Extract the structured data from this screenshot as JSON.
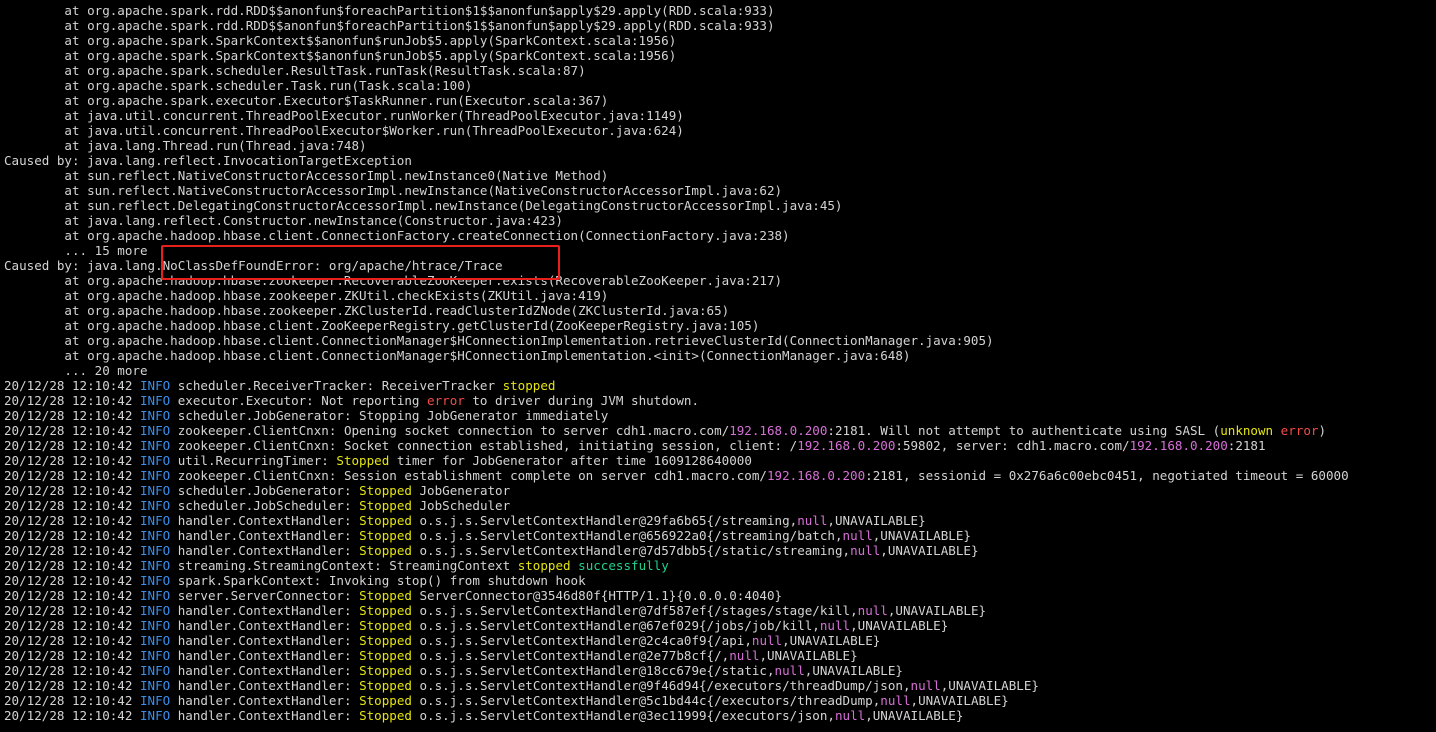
{
  "terminal": {
    "colors": {
      "background": "#000000",
      "text": "#d4d4d4",
      "info": "#3b8eea",
      "stopped": "#e5e510",
      "error": "#f14c4c",
      "ip": "#d670d6",
      "success": "#23d18b",
      "highlight_box": "#e8201c"
    },
    "lines": [
      [
        {
          "t": "        at org.apache.spark.rdd.RDD$$anonfun$foreachPartition$1$$anonfun$apply$29.apply(RDD.scala:933)",
          "c": "plain"
        }
      ],
      [
        {
          "t": "        at org.apache.spark.rdd.RDD$$anonfun$foreachPartition$1$$anonfun$apply$29.apply(RDD.scala:933)",
          "c": "plain"
        }
      ],
      [
        {
          "t": "        at org.apache.spark.SparkContext$$anonfun$runJob$5.apply(SparkContext.scala:1956)",
          "c": "plain"
        }
      ],
      [
        {
          "t": "        at org.apache.spark.SparkContext$$anonfun$runJob$5.apply(SparkContext.scala:1956)",
          "c": "plain"
        }
      ],
      [
        {
          "t": "        at org.apache.spark.scheduler.ResultTask.runTask(ResultTask.scala:87)",
          "c": "plain"
        }
      ],
      [
        {
          "t": "        at org.apache.spark.scheduler.Task.run(Task.scala:100)",
          "c": "plain"
        }
      ],
      [
        {
          "t": "        at org.apache.spark.executor.Executor$TaskRunner.run(Executor.scala:367)",
          "c": "plain"
        }
      ],
      [
        {
          "t": "        at java.util.concurrent.ThreadPoolExecutor.runWorker(ThreadPoolExecutor.java:1149)",
          "c": "plain"
        }
      ],
      [
        {
          "t": "        at java.util.concurrent.ThreadPoolExecutor$Worker.run(ThreadPoolExecutor.java:624)",
          "c": "plain"
        }
      ],
      [
        {
          "t": "        at java.lang.Thread.run(Thread.java:748)",
          "c": "plain"
        }
      ],
      [
        {
          "t": "Caused by: java.lang.reflect.InvocationTargetException",
          "c": "plain"
        }
      ],
      [
        {
          "t": "        at sun.reflect.NativeConstructorAccessorImpl.newInstance0(Native Method)",
          "c": "plain"
        }
      ],
      [
        {
          "t": "        at sun.reflect.NativeConstructorAccessorImpl.newInstance(NativeConstructorAccessorImpl.java:62)",
          "c": "plain"
        }
      ],
      [
        {
          "t": "        at sun.reflect.DelegatingConstructorAccessorImpl.newInstance(DelegatingConstructorAccessorImpl.java:45)",
          "c": "plain"
        }
      ],
      [
        {
          "t": "        at java.lang.reflect.Constructor.newInstance(Constructor.java:423)",
          "c": "plain"
        }
      ],
      [
        {
          "t": "        at org.apache.hadoop.hbase.client.ConnectionFactory.createConnection(ConnectionFactory.java:238)",
          "c": "plain"
        }
      ],
      [
        {
          "t": "        ... 15 more",
          "c": "plain"
        }
      ],
      [
        {
          "t": "Caused by: java.lang.NoClassDefFoundError: org/apache/htrace/Trace",
          "c": "plain"
        }
      ],
      [
        {
          "t": "        at org.apache.hadoop.hbase.zookeeper.RecoverableZooKeeper.exists(RecoverableZooKeeper.java:217)",
          "c": "plain"
        }
      ],
      [
        {
          "t": "        at org.apache.hadoop.hbase.zookeeper.ZKUtil.checkExists(ZKUtil.java:419)",
          "c": "plain"
        }
      ],
      [
        {
          "t": "        at org.apache.hadoop.hbase.zookeeper.ZKClusterId.readClusterIdZNode(ZKClusterId.java:65)",
          "c": "plain"
        }
      ],
      [
        {
          "t": "        at org.apache.hadoop.hbase.client.ZooKeeperRegistry.getClusterId(ZooKeeperRegistry.java:105)",
          "c": "plain"
        }
      ],
      [
        {
          "t": "        at org.apache.hadoop.hbase.client.ConnectionManager$HConnectionImplementation.retrieveClusterId(ConnectionManager.java:905)",
          "c": "plain"
        }
      ],
      [
        {
          "t": "        at org.apache.hadoop.hbase.client.ConnectionManager$HConnectionImplementation.<init>(ConnectionManager.java:648)",
          "c": "plain"
        }
      ],
      [
        {
          "t": "        ... 20 more",
          "c": "plain"
        }
      ],
      [
        {
          "t": "20/12/28 12:10:42 ",
          "c": "plain"
        },
        {
          "t": "INFO",
          "c": "info"
        },
        {
          "t": " scheduler.ReceiverTracker: ReceiverTracker ",
          "c": "plain"
        },
        {
          "t": "stopped",
          "c": "stopped"
        }
      ],
      [
        {
          "t": "20/12/28 12:10:42 ",
          "c": "plain"
        },
        {
          "t": "INFO",
          "c": "info"
        },
        {
          "t": " executor.Executor: Not reporting ",
          "c": "plain"
        },
        {
          "t": "error",
          "c": "error"
        },
        {
          "t": " to driver during JVM shutdown.",
          "c": "plain"
        }
      ],
      [
        {
          "t": "20/12/28 12:10:42 ",
          "c": "plain"
        },
        {
          "t": "INFO",
          "c": "info"
        },
        {
          "t": " scheduler.JobGenerator: Stopping JobGenerator immediately",
          "c": "plain"
        }
      ],
      [
        {
          "t": "20/12/28 12:10:42 ",
          "c": "plain"
        },
        {
          "t": "INFO",
          "c": "info"
        },
        {
          "t": " zookeeper.ClientCnxn: Opening socket connection to server cdh1.macro.com/",
          "c": "plain"
        },
        {
          "t": "192.168.0.200",
          "c": "ip"
        },
        {
          "t": ":2181. Will not attempt to authenticate using SASL (",
          "c": "plain"
        },
        {
          "t": "unknown",
          "c": "stopped"
        },
        {
          "t": " ",
          "c": "plain"
        },
        {
          "t": "error",
          "c": "error"
        },
        {
          "t": ")",
          "c": "plain"
        }
      ],
      [
        {
          "t": "20/12/28 12:10:42 ",
          "c": "plain"
        },
        {
          "t": "INFO",
          "c": "info"
        },
        {
          "t": " zookeeper.ClientCnxn: Socket connection established, initiating session, client: /",
          "c": "plain"
        },
        {
          "t": "192.168.0.200",
          "c": "ip"
        },
        {
          "t": ":59802, server: cdh1.macro.com/",
          "c": "plain"
        },
        {
          "t": "192.168.0.200",
          "c": "ip"
        },
        {
          "t": ":2181",
          "c": "plain"
        }
      ],
      [
        {
          "t": "20/12/28 12:10:42 ",
          "c": "plain"
        },
        {
          "t": "INFO",
          "c": "info"
        },
        {
          "t": " util.RecurringTimer: ",
          "c": "plain"
        },
        {
          "t": "Stopped",
          "c": "stopped"
        },
        {
          "t": " timer for JobGenerator after time 1609128640000",
          "c": "plain"
        }
      ],
      [
        {
          "t": "20/12/28 12:10:42 ",
          "c": "plain"
        },
        {
          "t": "INFO",
          "c": "info"
        },
        {
          "t": " zookeeper.ClientCnxn: Session establishment complete on server cdh1.macro.com/",
          "c": "plain"
        },
        {
          "t": "192.168.0.200",
          "c": "ip"
        },
        {
          "t": ":2181, sessionid = 0x276a6c00ebc0451, negotiated timeout = 60000",
          "c": "plain"
        }
      ],
      [
        {
          "t": "20/12/28 12:10:42 ",
          "c": "plain"
        },
        {
          "t": "INFO",
          "c": "info"
        },
        {
          "t": " scheduler.JobGenerator: ",
          "c": "plain"
        },
        {
          "t": "Stopped",
          "c": "stopped"
        },
        {
          "t": " JobGenerator",
          "c": "plain"
        }
      ],
      [
        {
          "t": "20/12/28 12:10:42 ",
          "c": "plain"
        },
        {
          "t": "INFO",
          "c": "info"
        },
        {
          "t": " scheduler.JobScheduler: ",
          "c": "plain"
        },
        {
          "t": "Stopped",
          "c": "stopped"
        },
        {
          "t": " JobScheduler",
          "c": "plain"
        }
      ],
      [
        {
          "t": "20/12/28 12:10:42 ",
          "c": "plain"
        },
        {
          "t": "INFO",
          "c": "info"
        },
        {
          "t": " handler.ContextHandler: ",
          "c": "plain"
        },
        {
          "t": "Stopped",
          "c": "stopped"
        },
        {
          "t": " o.s.j.s.ServletContextHandler@29fa6b65{/streaming,",
          "c": "plain"
        },
        {
          "t": "null",
          "c": "null"
        },
        {
          "t": ",UNAVAILABLE}",
          "c": "plain"
        }
      ],
      [
        {
          "t": "20/12/28 12:10:42 ",
          "c": "plain"
        },
        {
          "t": "INFO",
          "c": "info"
        },
        {
          "t": " handler.ContextHandler: ",
          "c": "plain"
        },
        {
          "t": "Stopped",
          "c": "stopped"
        },
        {
          "t": " o.s.j.s.ServletContextHandler@656922a0{/streaming/batch,",
          "c": "plain"
        },
        {
          "t": "null",
          "c": "null"
        },
        {
          "t": ",UNAVAILABLE}",
          "c": "plain"
        }
      ],
      [
        {
          "t": "20/12/28 12:10:42 ",
          "c": "plain"
        },
        {
          "t": "INFO",
          "c": "info"
        },
        {
          "t": " handler.ContextHandler: ",
          "c": "plain"
        },
        {
          "t": "Stopped",
          "c": "stopped"
        },
        {
          "t": " o.s.j.s.ServletContextHandler@7d57dbb5{/static/streaming,",
          "c": "plain"
        },
        {
          "t": "null",
          "c": "null"
        },
        {
          "t": ",UNAVAILABLE}",
          "c": "plain"
        }
      ],
      [
        {
          "t": "20/12/28 12:10:42 ",
          "c": "plain"
        },
        {
          "t": "INFO",
          "c": "info"
        },
        {
          "t": " streaming.StreamingContext: StreamingContext ",
          "c": "plain"
        },
        {
          "t": "stopped",
          "c": "stopped"
        },
        {
          "t": " ",
          "c": "plain"
        },
        {
          "t": "successfully",
          "c": "success"
        }
      ],
      [
        {
          "t": "20/12/28 12:10:42 ",
          "c": "plain"
        },
        {
          "t": "INFO",
          "c": "info"
        },
        {
          "t": " spark.SparkContext: Invoking stop() from shutdown hook",
          "c": "plain"
        }
      ],
      [
        {
          "t": "20/12/28 12:10:42 ",
          "c": "plain"
        },
        {
          "t": "INFO",
          "c": "info"
        },
        {
          "t": " server.ServerConnector: ",
          "c": "plain"
        },
        {
          "t": "Stopped",
          "c": "stopped"
        },
        {
          "t": " ServerConnector@3546d80f{HTTP/1.1}{0.0.0.0:4040}",
          "c": "plain"
        }
      ],
      [
        {
          "t": "20/12/28 12:10:42 ",
          "c": "plain"
        },
        {
          "t": "INFO",
          "c": "info"
        },
        {
          "t": " handler.ContextHandler: ",
          "c": "plain"
        },
        {
          "t": "Stopped",
          "c": "stopped"
        },
        {
          "t": " o.s.j.s.ServletContextHandler@7df587ef{/stages/stage/kill,",
          "c": "plain"
        },
        {
          "t": "null",
          "c": "null"
        },
        {
          "t": ",UNAVAILABLE}",
          "c": "plain"
        }
      ],
      [
        {
          "t": "20/12/28 12:10:42 ",
          "c": "plain"
        },
        {
          "t": "INFO",
          "c": "info"
        },
        {
          "t": " handler.ContextHandler: ",
          "c": "plain"
        },
        {
          "t": "Stopped",
          "c": "stopped"
        },
        {
          "t": " o.s.j.s.ServletContextHandler@67ef029{/jobs/job/kill,",
          "c": "plain"
        },
        {
          "t": "null",
          "c": "null"
        },
        {
          "t": ",UNAVAILABLE}",
          "c": "plain"
        }
      ],
      [
        {
          "t": "20/12/28 12:10:42 ",
          "c": "plain"
        },
        {
          "t": "INFO",
          "c": "info"
        },
        {
          "t": " handler.ContextHandler: ",
          "c": "plain"
        },
        {
          "t": "Stopped",
          "c": "stopped"
        },
        {
          "t": " o.s.j.s.ServletContextHandler@2c4ca0f9{/api,",
          "c": "plain"
        },
        {
          "t": "null",
          "c": "null"
        },
        {
          "t": ",UNAVAILABLE}",
          "c": "plain"
        }
      ],
      [
        {
          "t": "20/12/28 12:10:42 ",
          "c": "plain"
        },
        {
          "t": "INFO",
          "c": "info"
        },
        {
          "t": " handler.ContextHandler: ",
          "c": "plain"
        },
        {
          "t": "Stopped",
          "c": "stopped"
        },
        {
          "t": " o.s.j.s.ServletContextHandler@2e77b8cf{/,",
          "c": "plain"
        },
        {
          "t": "null",
          "c": "null"
        },
        {
          "t": ",UNAVAILABLE}",
          "c": "plain"
        }
      ],
      [
        {
          "t": "20/12/28 12:10:42 ",
          "c": "plain"
        },
        {
          "t": "INFO",
          "c": "info"
        },
        {
          "t": " handler.ContextHandler: ",
          "c": "plain"
        },
        {
          "t": "Stopped",
          "c": "stopped"
        },
        {
          "t": " o.s.j.s.ServletContextHandler@18cc679e{/static,",
          "c": "plain"
        },
        {
          "t": "null",
          "c": "null"
        },
        {
          "t": ",UNAVAILABLE}",
          "c": "plain"
        }
      ],
      [
        {
          "t": "20/12/28 12:10:42 ",
          "c": "plain"
        },
        {
          "t": "INFO",
          "c": "info"
        },
        {
          "t": " handler.ContextHandler: ",
          "c": "plain"
        },
        {
          "t": "Stopped",
          "c": "stopped"
        },
        {
          "t": " o.s.j.s.ServletContextHandler@9f46d94{/executors/threadDump/json,",
          "c": "plain"
        },
        {
          "t": "null",
          "c": "null"
        },
        {
          "t": ",UNAVAILABLE}",
          "c": "plain"
        }
      ],
      [
        {
          "t": "20/12/28 12:10:42 ",
          "c": "plain"
        },
        {
          "t": "INFO",
          "c": "info"
        },
        {
          "t": " handler.ContextHandler: ",
          "c": "plain"
        },
        {
          "t": "Stopped",
          "c": "stopped"
        },
        {
          "t": " o.s.j.s.ServletContextHandler@5c1bd44c{/executors/threadDump,",
          "c": "plain"
        },
        {
          "t": "null",
          "c": "null"
        },
        {
          "t": ",UNAVAILABLE}",
          "c": "plain"
        }
      ],
      [
        {
          "t": "20/12/28 12:10:42 ",
          "c": "plain"
        },
        {
          "t": "INFO",
          "c": "info"
        },
        {
          "t": " handler.ContextHandler: ",
          "c": "plain"
        },
        {
          "t": "Stopped",
          "c": "stopped"
        },
        {
          "t": " o.s.j.s.ServletContextHandler@3ec11999{/executors/json,",
          "c": "plain"
        },
        {
          "t": "null",
          "c": "null"
        },
        {
          "t": ",UNAVAILABLE}",
          "c": "plain"
        }
      ]
    ]
  }
}
